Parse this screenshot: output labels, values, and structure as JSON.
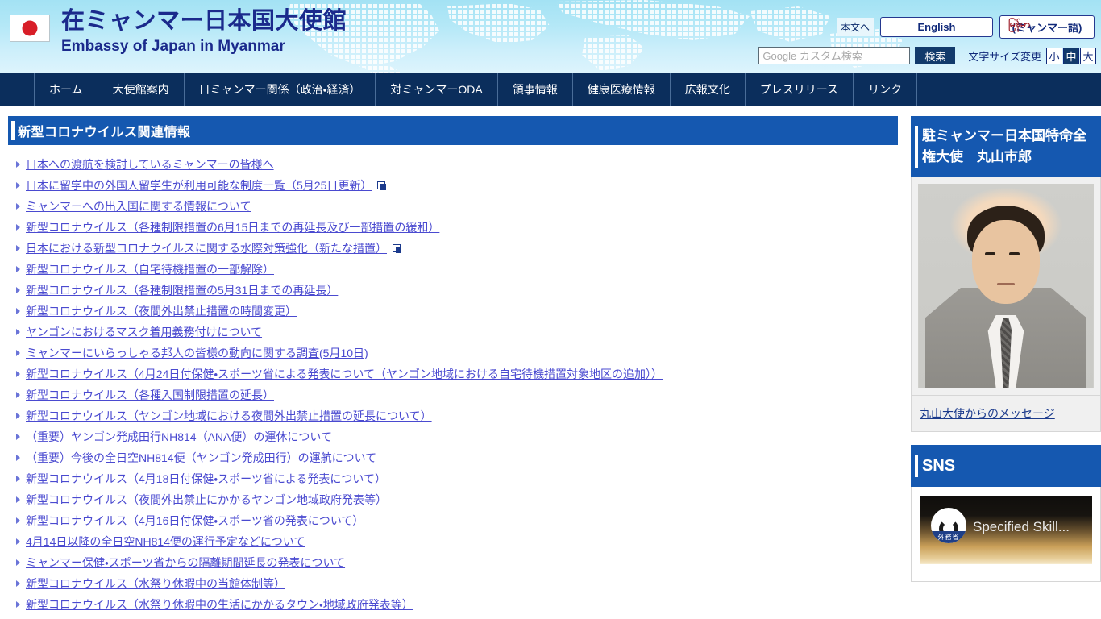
{
  "header": {
    "flag_icon": "japan-flag-icon",
    "title_ja": "在ミャンマー日本国大使館",
    "title_en": "Embassy of Japan in Myanmar",
    "skip_link": "本文へ",
    "lang_english": "English",
    "lang_myanmar": "(ミャンマー語)",
    "lang_myanmar_burmese": "မြန်မာ",
    "search_placeholder": "Google カスタム検索",
    "search_value": "",
    "search_button": "検索",
    "fontsize_label": "文字サイズ変更",
    "fontsize_options": [
      {
        "label": "小",
        "active": false
      },
      {
        "label": "中",
        "active": true
      },
      {
        "label": "大",
        "active": false
      }
    ],
    "colors": {
      "gradient_top": "#a3e2f4",
      "gradient_bottom": "#ddf4fc",
      "brand_text": "#1b2a8c",
      "flag_red": "#d81e28"
    }
  },
  "nav": {
    "items": [
      {
        "label": "ホーム"
      },
      {
        "label": "大使館案内"
      },
      {
        "label": "日ミャンマー関係（政治・経済）"
      },
      {
        "label": "対ミャンマーODA"
      },
      {
        "label": "領事情報"
      },
      {
        "label": "健康医療情報"
      },
      {
        "label": "広報文化"
      },
      {
        "label": "プレスリリース"
      },
      {
        "label": "リンク"
      }
    ],
    "colors": {
      "background": "#0b2e5c",
      "text": "#ffffff",
      "divider": "#4a6d98"
    }
  },
  "main": {
    "section_title": "新型コロナウイルス関連情報",
    "section_color": "#1558b0",
    "link_color": "#4a4ad0",
    "links": [
      {
        "text": "日本への渡航を検討しているミャンマーの皆様へ",
        "external": false
      },
      {
        "text": "日本に留学中の外国人留学生が利用可能な制度一覧（5月25日更新）",
        "external": true
      },
      {
        "text": "ミャンマーへの出入国に関する情報について",
        "external": false
      },
      {
        "text": "新型コロナウイルス（各種制限措置の6月15日までの再延長及び一部措置の緩和）",
        "external": false
      },
      {
        "text": "日本における新型コロナウイルスに関する水際対策強化（新たな措置）",
        "external": true
      },
      {
        "text": "新型コロナウイルス（自宅待機措置の一部解除）",
        "external": false
      },
      {
        "text": "新型コロナウイルス（各種制限措置の5月31日までの再延長）",
        "external": false
      },
      {
        "text": "新型コロナウイルス（夜間外出禁止措置の時間変更）",
        "external": false
      },
      {
        "text": "ヤンゴンにおけるマスク着用義務付けについて",
        "external": false
      },
      {
        "text": "ミャンマーにいらっしゃる邦人の皆様の動向に関する調査(5月10日)",
        "external": false
      },
      {
        "text": "新型コロナウイルス（4月24日付保健・スポーツ省による発表について（ヤンゴン地域における自宅待機措置対象地区の追加））",
        "external": false
      },
      {
        "text": "新型コロナウイルス（各種入国制限措置の延長）",
        "external": false
      },
      {
        "text": "新型コロナウイルス（ヤンゴン地域における夜間外出禁止措置の延長について）",
        "external": false
      },
      {
        "text": "（重要）ヤンゴン発成田行NH814（ANA便）の運休について",
        "external": false
      },
      {
        "text": "（重要）今後の全日空NH814便（ヤンゴン発成田行）の運航について",
        "external": false
      },
      {
        "text": "新型コロナウイルス（4月18日付保健・スポーツ省による発表について）",
        "external": false
      },
      {
        "text": "新型コロナウイルス（夜間外出禁止にかかるヤンゴン地域政府発表等）",
        "external": false
      },
      {
        "text": "新型コロナウイルス（4月16日付保健・スポーツ省の発表について）",
        "external": false
      },
      {
        "text": "4月14日以降の全日空NH814便の運行予定などについて",
        "external": false
      },
      {
        "text": "ミャンマー保健・スポーツ省からの隔離期間延長の発表について",
        "external": false
      },
      {
        "text": "新型コロナウイルス（水祭り休暇中の当館体制等）",
        "external": false
      },
      {
        "text": "新型コロナウイルス（水祭り休暇中の生活にかかるタウン・地域政府発表等）",
        "external": false
      }
    ]
  },
  "sidebar": {
    "ambassador": {
      "heading": "駐ミャンマー日本国特命全権大使　丸山市郎",
      "photo_alt": "ambassador-photo",
      "message_link": "丸山大使からのメッセージ"
    },
    "sns": {
      "heading": "SNS",
      "video_title": "Specified Skill...",
      "logo_label": "外務省"
    }
  }
}
